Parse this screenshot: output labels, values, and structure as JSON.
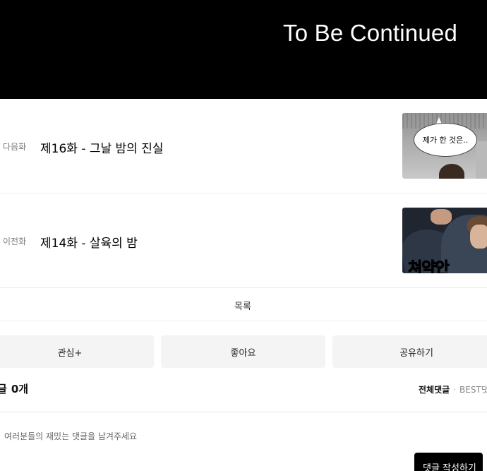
{
  "banner": {
    "title": "To Be Continued"
  },
  "episodes": {
    "next": {
      "tag": "다음화",
      "title": "제16화 - 그날 밤의 진실",
      "thumb_text": "제가 한 것은.."
    },
    "prev": {
      "tag": "이전화",
      "title": "제14화 - 살육의 밤",
      "thumb_sfx": "쳐약안"
    }
  },
  "list": {
    "label": "목록"
  },
  "actions": {
    "favorite": "관심+",
    "like": "좋아요",
    "share": "공유하기"
  },
  "comments": {
    "label": "글",
    "count": "0개",
    "tab_all": "전체댓글",
    "tab_sep": "·",
    "tab_best": "BEST댓",
    "placeholder": "여러분들의 재밌는 댓글을 남겨주세요",
    "write_button": "댓글 작성하기"
  }
}
